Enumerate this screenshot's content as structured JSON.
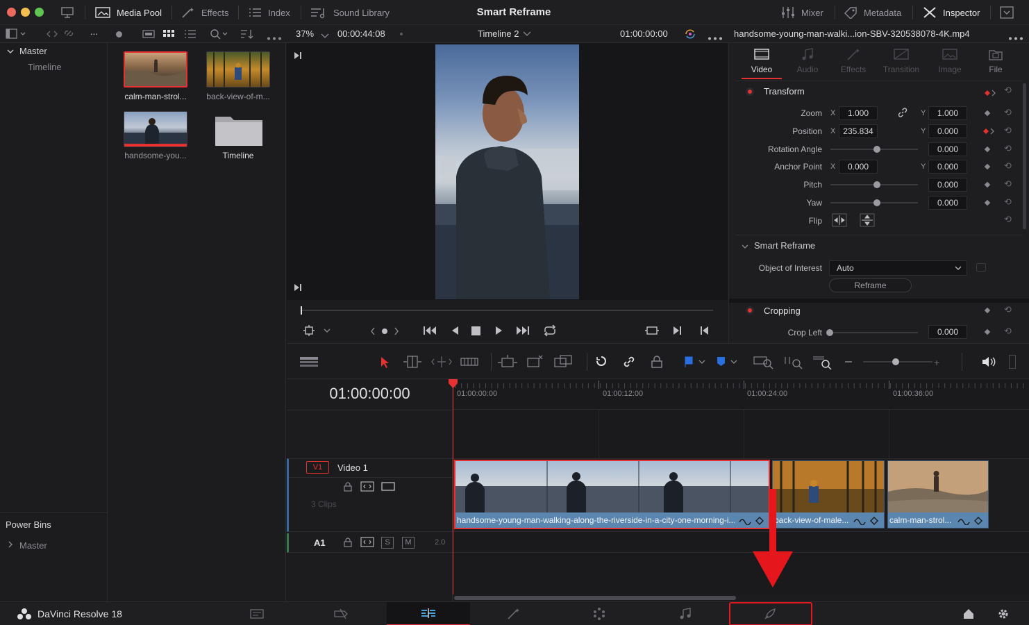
{
  "topbar": {
    "media_pool": "Media Pool",
    "effects": "Effects",
    "index": "Index",
    "sound_library": "Sound Library",
    "title": "Smart Reframe",
    "mixer": "Mixer",
    "metadata": "Metadata",
    "inspector": "Inspector"
  },
  "subbar": {
    "more": "...",
    "zoom": "37%",
    "source_timecode": "00:00:44:08",
    "timeline_name": "Timeline 2",
    "record_timecode": "01:00:00:00",
    "clip_filename": "handsome-young-man-walki...ion-SBV-320538078-4K.mp4"
  },
  "bins": {
    "master": "Master",
    "timeline": "Timeline",
    "power_bins": "Power Bins",
    "power_master": "Master"
  },
  "media": [
    {
      "label": "calm-man-strol..."
    },
    {
      "label": "back-view-of-m..."
    },
    {
      "label": "handsome-you..."
    },
    {
      "label": "Timeline"
    }
  ],
  "inspector": {
    "tabs": [
      "Video",
      "Audio",
      "Effects",
      "Transition",
      "Image",
      "File"
    ],
    "transform": "Transform",
    "zoom_label": "Zoom",
    "zoom_x": "1.000",
    "zoom_y": "1.000",
    "position_label": "Position",
    "position_x": "235.834",
    "position_y": "0.000",
    "rotation_label": "Rotation Angle",
    "rotation_value": "0.000",
    "anchor_label": "Anchor Point",
    "anchor_x": "0.000",
    "anchor_y": "0.000",
    "pitch_label": "Pitch",
    "pitch_value": "0.000",
    "yaw_label": "Yaw",
    "yaw_value": "0.000",
    "flip_label": "Flip",
    "smart_reframe": "Smart Reframe",
    "object_label": "Object of Interest",
    "object_value": "Auto",
    "reframe_button": "Reframe",
    "cropping": "Cropping",
    "crop_left_label": "Crop Left",
    "crop_left_value": "0.000",
    "x": "X",
    "y": "Y"
  },
  "timeline": {
    "timecode": "01:00:00:00",
    "ruler": [
      "01:00:00:00",
      "01:00:12:00",
      "01:00:24:00",
      "01:00:36:00"
    ],
    "v1": "V1",
    "video1": "Video 1",
    "clips_count": "3 Clips",
    "a1": "A1",
    "a1_s": "S",
    "a1_m": "M",
    "a1_level": "2.0",
    "clips": [
      {
        "name": "handsome-young-man-walking-along-the-riverside-in-a-city-one-morning-i..."
      },
      {
        "name": "back-view-of-male..."
      },
      {
        "name": "calm-man-strol..."
      }
    ]
  },
  "pagebar": {
    "app_name": "DaVinci Resolve 18"
  },
  "colors": {
    "accent_red": "#e5312f",
    "playhead": "#e5312f",
    "clip_blue": "#5b86b0",
    "bg": "#1b1b1e"
  }
}
